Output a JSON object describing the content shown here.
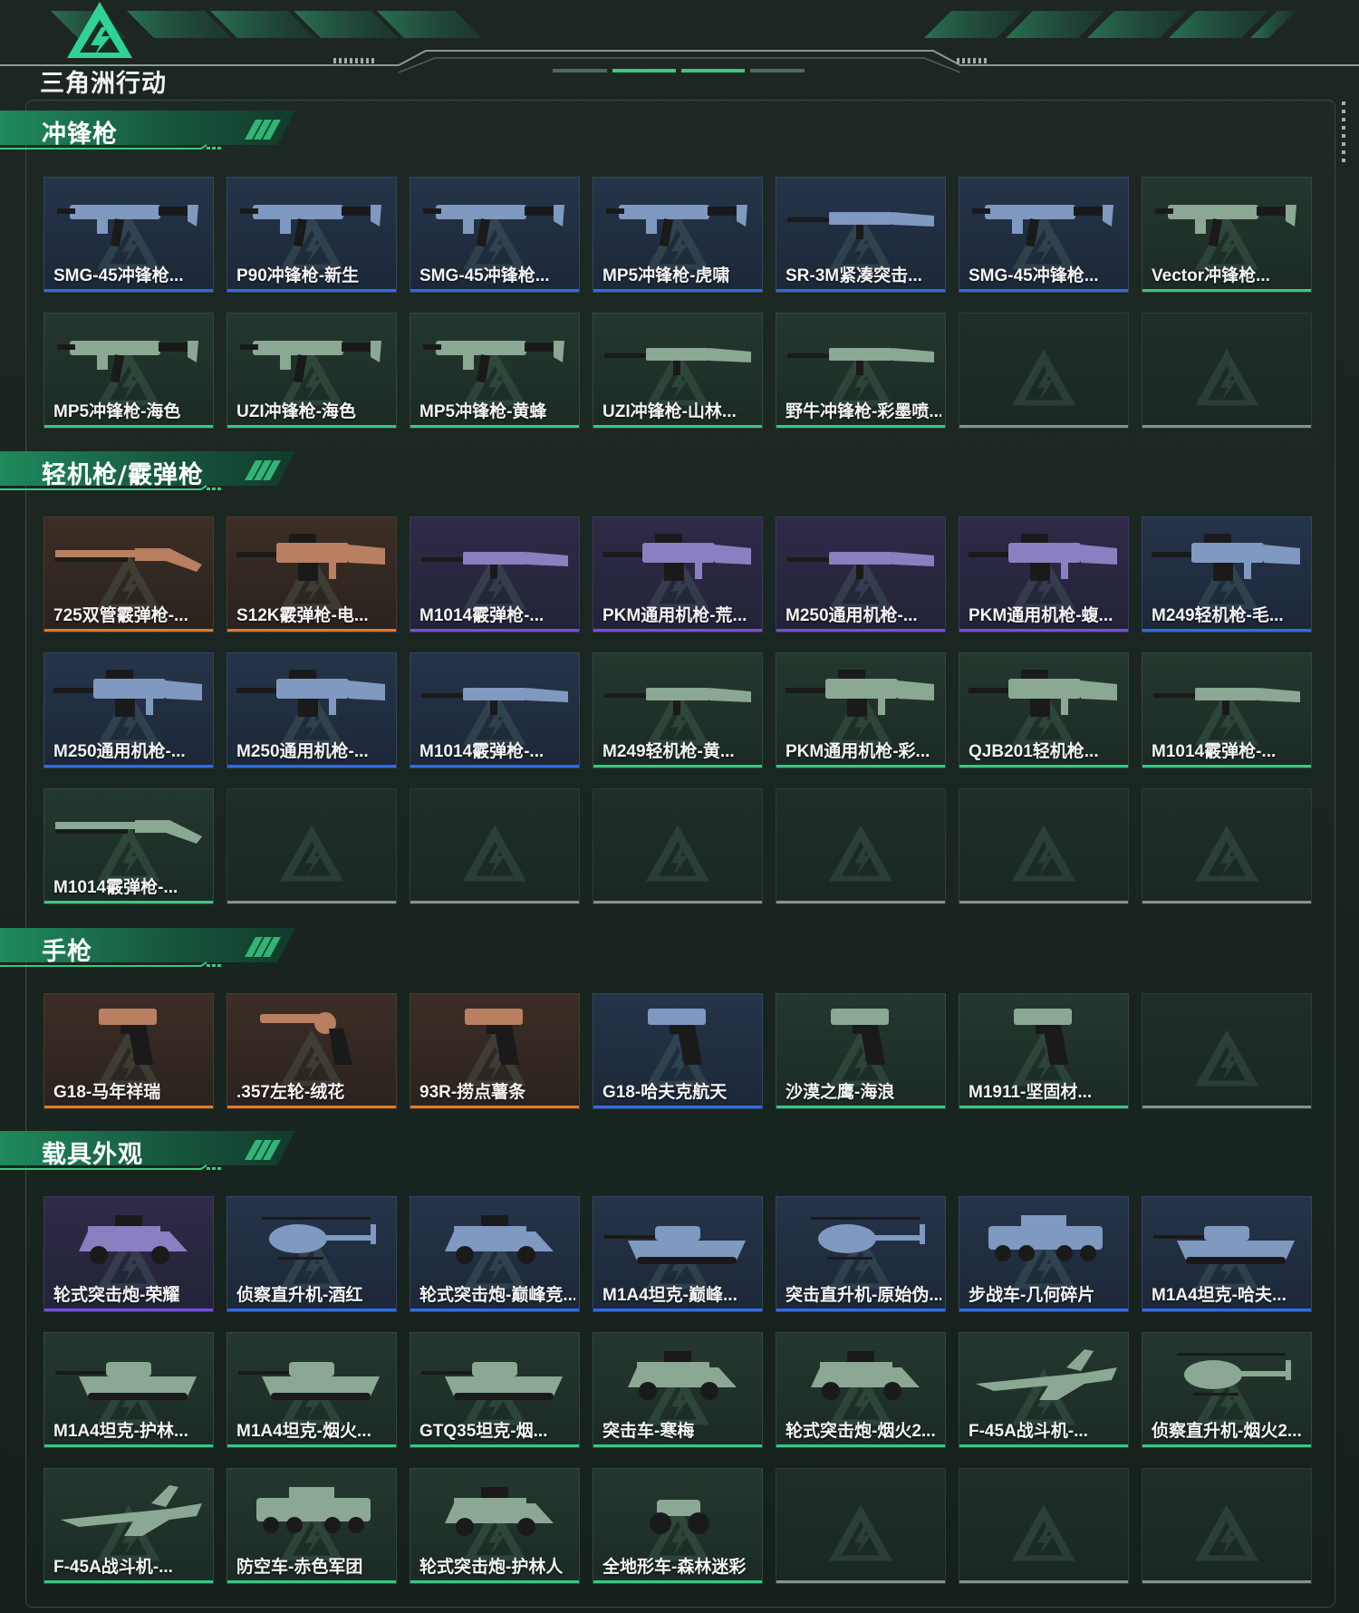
{
  "app": {
    "logo_text": "三角洲行动",
    "colors": {
      "accent_green": "#37c982",
      "quality_purple": "#7b4be0",
      "quality_blue": "#2f6ce6",
      "quality_orange": "#e07a2c",
      "quality_green": "#37c982"
    }
  },
  "sections": [
    {
      "title": "冲锋枪",
      "items": [
        {
          "label": "SMG-45冲锋枪...",
          "quality": "blue",
          "icon": "smg-icon"
        },
        {
          "label": "P90冲锋枪-新生",
          "quality": "blue",
          "icon": "smg-icon"
        },
        {
          "label": "SMG-45冲锋枪...",
          "quality": "blue",
          "icon": "smg-icon"
        },
        {
          "label": "MP5冲锋枪-虎啸",
          "quality": "blue",
          "icon": "smg-icon"
        },
        {
          "label": "SR-3M紧凑突击...",
          "quality": "blue",
          "icon": "rifle-icon"
        },
        {
          "label": "SMG-45冲锋枪...",
          "quality": "blue",
          "icon": "smg-icon"
        },
        {
          "label": "Vector冲锋枪...",
          "quality": "green",
          "icon": "smg-icon"
        },
        {
          "label": "MP5冲锋枪-海色",
          "quality": "green",
          "icon": "smg-icon"
        },
        {
          "label": "UZI冲锋枪-海色",
          "quality": "green",
          "icon": "smg-icon"
        },
        {
          "label": "MP5冲锋枪-黄蜂",
          "quality": "green",
          "icon": "smg-icon"
        },
        {
          "label": "UZI冲锋枪-山林...",
          "quality": "green",
          "icon": "rifle-icon"
        },
        {
          "label": "野牛冲锋枪-彩墨喷...",
          "quality": "green",
          "icon": "rifle-icon"
        },
        {
          "label": "",
          "quality": "empty",
          "icon": ""
        },
        {
          "label": "",
          "quality": "empty",
          "icon": ""
        }
      ]
    },
    {
      "title": "轻机枪/霰弹枪",
      "items": [
        {
          "label": "725双管霰弹枪-...",
          "quality": "orange",
          "icon": "shotgun-icon"
        },
        {
          "label": "S12K霰弹枪-电...",
          "quality": "orange",
          "icon": "machinegun-icon"
        },
        {
          "label": "M1014霰弹枪-...",
          "quality": "purple",
          "icon": "rifle-icon"
        },
        {
          "label": "PKM通用机枪-荒...",
          "quality": "purple",
          "icon": "machinegun-icon"
        },
        {
          "label": "M250通用机枪-...",
          "quality": "purple",
          "icon": "rifle-icon"
        },
        {
          "label": "PKM通用机枪-蝮...",
          "quality": "purple",
          "icon": "machinegun-icon"
        },
        {
          "label": "M249轻机枪-毛...",
          "quality": "blue",
          "icon": "machinegun-icon"
        },
        {
          "label": "M250通用机枪-...",
          "quality": "blue",
          "icon": "machinegun-icon"
        },
        {
          "label": "M250通用机枪-...",
          "quality": "blue",
          "icon": "machinegun-icon"
        },
        {
          "label": "M1014霰弹枪-...",
          "quality": "blue",
          "icon": "rifle-icon"
        },
        {
          "label": "M249轻机枪-黄...",
          "quality": "green",
          "icon": "rifle-icon"
        },
        {
          "label": "PKM通用机枪-彩...",
          "quality": "green",
          "icon": "machinegun-icon"
        },
        {
          "label": "QJB201轻机枪...",
          "quality": "green",
          "icon": "machinegun-icon"
        },
        {
          "label": "M1014霰弹枪-...",
          "quality": "green",
          "icon": "rifle-icon"
        },
        {
          "label": "M1014霰弹枪-...",
          "quality": "green",
          "icon": "shotgun-icon"
        },
        {
          "label": "",
          "quality": "empty",
          "icon": ""
        },
        {
          "label": "",
          "quality": "empty",
          "icon": ""
        },
        {
          "label": "",
          "quality": "empty",
          "icon": ""
        },
        {
          "label": "",
          "quality": "empty",
          "icon": ""
        },
        {
          "label": "",
          "quality": "empty",
          "icon": ""
        },
        {
          "label": "",
          "quality": "empty",
          "icon": ""
        }
      ]
    },
    {
      "title": "手枪",
      "items": [
        {
          "label": "G18-马年祥瑞",
          "quality": "orange",
          "icon": "pistol-icon"
        },
        {
          "label": ".357左轮-绒花",
          "quality": "orange",
          "icon": "revolver-icon"
        },
        {
          "label": "93R-捞点薯条",
          "quality": "orange",
          "icon": "pistol-icon"
        },
        {
          "label": "G18-哈夫克航天",
          "quality": "blue",
          "icon": "pistol-icon"
        },
        {
          "label": "沙漠之鹰-海浪",
          "quality": "green",
          "icon": "pistol-icon"
        },
        {
          "label": "M1911-坚固材...",
          "quality": "green",
          "icon": "pistol-icon"
        },
        {
          "label": "",
          "quality": "empty",
          "icon": ""
        }
      ]
    },
    {
      "title": "载具外观",
      "items": [
        {
          "label": "轮式突击炮-荣耀",
          "quality": "purple",
          "icon": "armored-car-icon"
        },
        {
          "label": "侦察直升机-酒红",
          "quality": "blue",
          "icon": "helicopter-icon"
        },
        {
          "label": "轮式突击炮-巅峰竞...",
          "quality": "blue",
          "icon": "armored-car-icon"
        },
        {
          "label": "M1A4坦克-巅峰...",
          "quality": "blue",
          "icon": "tank-icon"
        },
        {
          "label": "突击直升机-原始伪...",
          "quality": "blue",
          "icon": "helicopter-icon"
        },
        {
          "label": "步战车-几何碎片",
          "quality": "blue",
          "icon": "ifv-icon"
        },
        {
          "label": "M1A4坦克-哈夫...",
          "quality": "blue",
          "icon": "tank-icon"
        },
        {
          "label": "M1A4坦克-护林...",
          "quality": "green",
          "icon": "tank-icon"
        },
        {
          "label": "M1A4坦克-烟火...",
          "quality": "green",
          "icon": "tank-icon"
        },
        {
          "label": "GTQ35坦克-烟...",
          "quality": "green",
          "icon": "tank-icon"
        },
        {
          "label": "突击车-寒梅",
          "quality": "green",
          "icon": "armored-car-icon"
        },
        {
          "label": "轮式突击炮-烟火2...",
          "quality": "green",
          "icon": "armored-car-icon"
        },
        {
          "label": "F-45A战斗机-...",
          "quality": "green",
          "icon": "jet-icon"
        },
        {
          "label": "侦察直升机-烟火2...",
          "quality": "green",
          "icon": "helicopter-icon"
        },
        {
          "label": "F-45A战斗机-...",
          "quality": "green",
          "icon": "jet-icon"
        },
        {
          "label": "防空车-赤色军团",
          "quality": "green",
          "icon": "ifv-icon"
        },
        {
          "label": "轮式突击炮-护林人",
          "quality": "green",
          "icon": "armored-car-icon"
        },
        {
          "label": "全地形车-森林迷彩",
          "quality": "green",
          "icon": "atv-icon"
        },
        {
          "label": "",
          "quality": "empty",
          "icon": ""
        },
        {
          "label": "",
          "quality": "empty",
          "icon": ""
        },
        {
          "label": "",
          "quality": "empty",
          "icon": ""
        }
      ]
    }
  ]
}
